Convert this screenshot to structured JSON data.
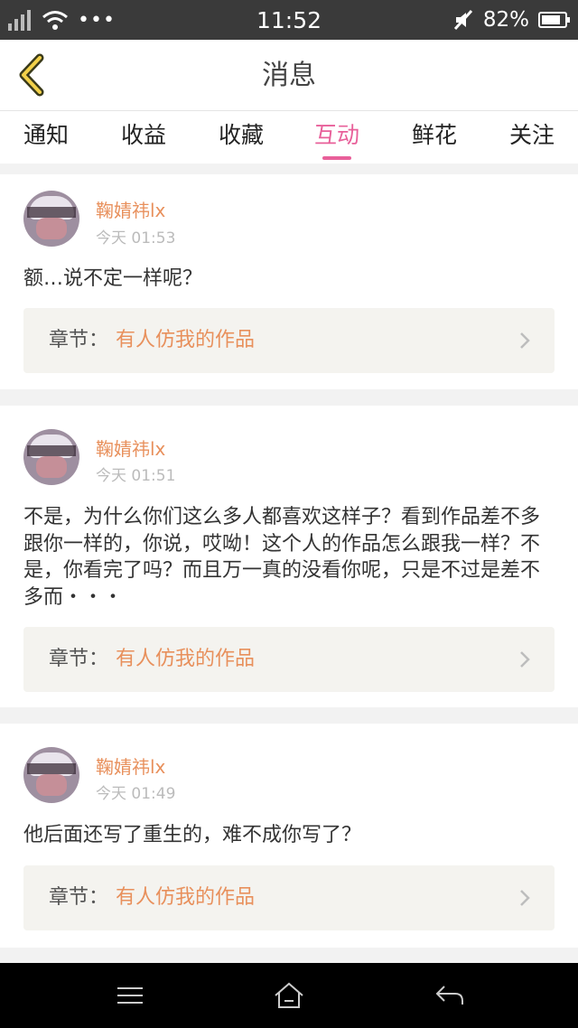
{
  "status_bar": {
    "time": "11:52",
    "battery": "82%",
    "dots": "•••",
    "icons": [
      "signal-icon",
      "wifi-icon",
      "more-icon",
      "mute-icon",
      "battery-icon"
    ]
  },
  "header": {
    "title": "消息",
    "back_icon": "chevron-left-icon"
  },
  "tabs": [
    {
      "label": "通知"
    },
    {
      "label": "收益"
    },
    {
      "label": "收藏"
    },
    {
      "label": "互动",
      "active": true
    },
    {
      "label": "鲜花"
    },
    {
      "label": "关注"
    }
  ],
  "messages": [
    {
      "user": "鞠婧祎lx",
      "time": "今天 01:53",
      "text": "额…说不定一样呢？",
      "chapter_label": "章节：",
      "chapter_name": "有人仿我的作品"
    },
    {
      "user": "鞠婧祎lx",
      "time": "今天 01:51",
      "text": "不是，为什么你们这么多人都喜欢这样子？看到作品差不多跟你一样的，你说，哎呦！这个人的作品怎么跟我一样？不是，你看完了吗？而且万一真的没看你呢，只是不过是差不多而・・・",
      "chapter_label": "章节：",
      "chapter_name": "有人仿我的作品"
    },
    {
      "user": "鞠婧祎lx",
      "time": "今天 01:49",
      "text": "他后面还写了重生的，难不成你写了？",
      "chapter_label": "章节：",
      "chapter_name": "有人仿我的作品"
    }
  ],
  "colors": {
    "accent_pink": "#e8609a",
    "username_orange": "#e8905c",
    "chapter_bg": "#f4f3ef"
  },
  "nav_bar": {
    "icons": [
      "menu-icon",
      "home-icon",
      "back-icon"
    ]
  }
}
